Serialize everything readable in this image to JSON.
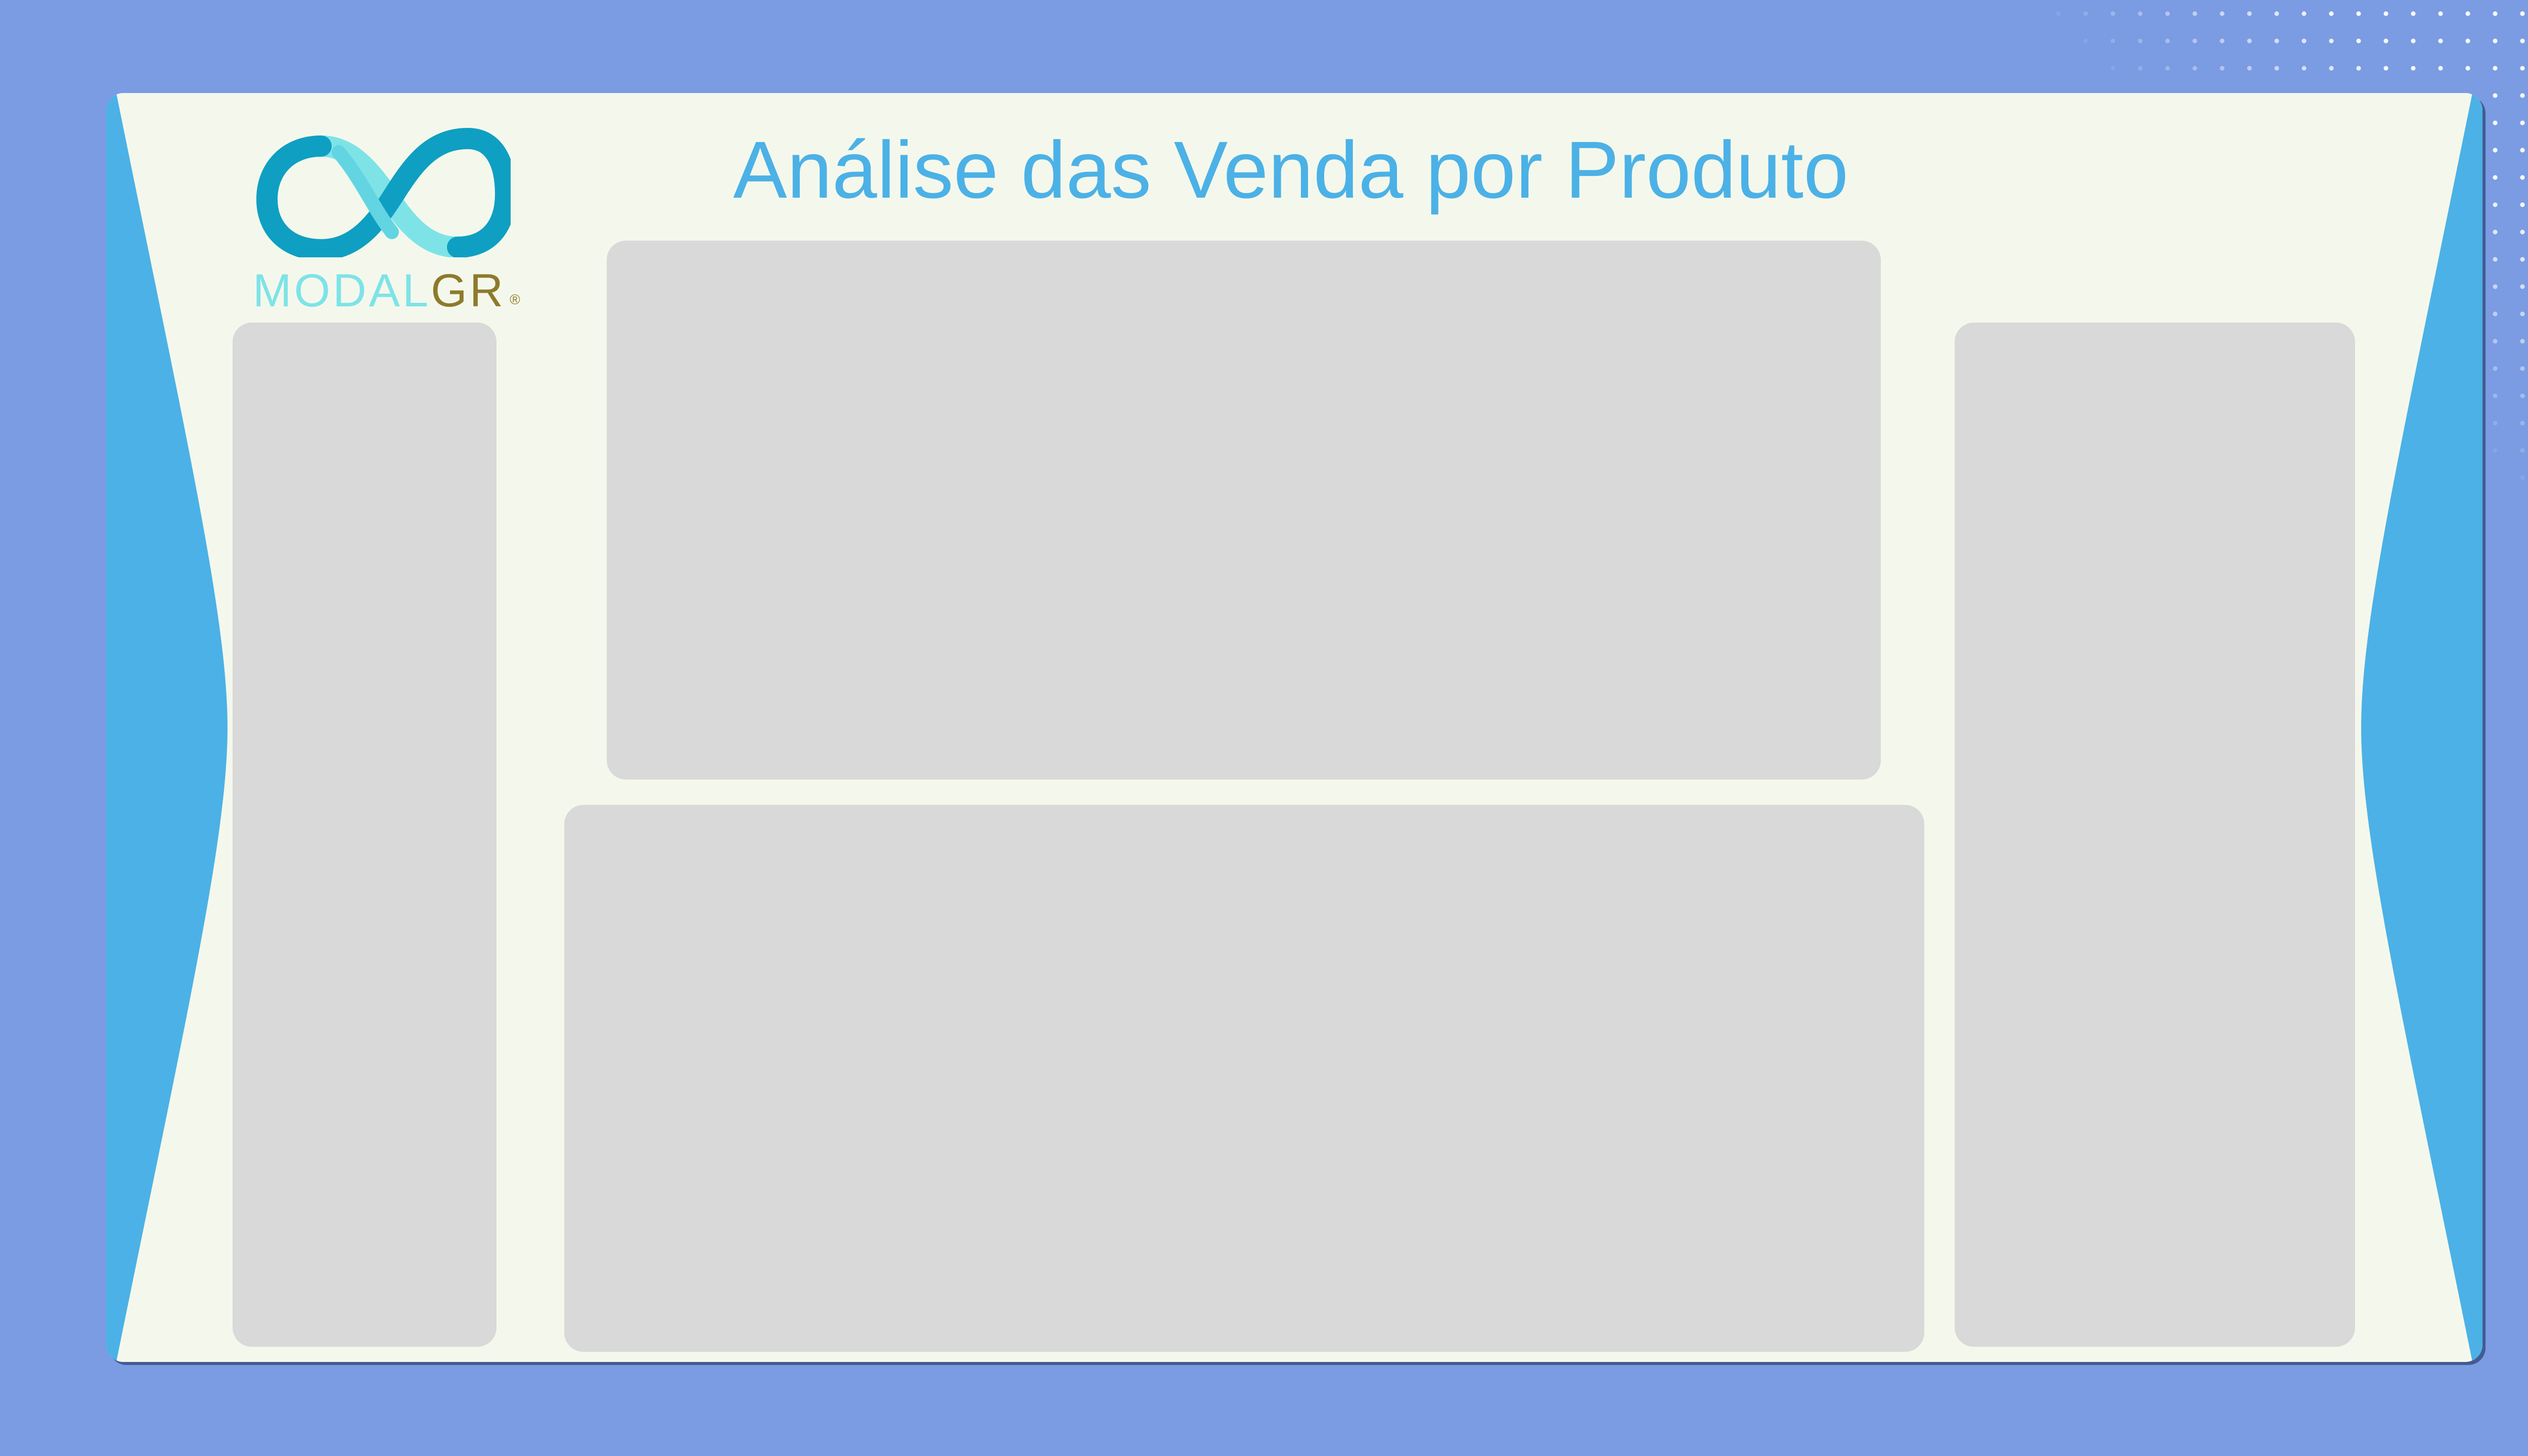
{
  "brand": {
    "logo_name": "MODAL",
    "logo_suffix": "GR",
    "registered_mark": "®",
    "colors": {
      "teal_light": "#7ee3e7",
      "teal_dark": "#0f9fc2",
      "gold": "#8f7a2b"
    }
  },
  "header": {
    "title": "Análise das Venda por Produto"
  },
  "theme": {
    "background": "#7b9be3",
    "card": "#f4f8ec",
    "accent_blue": "#4cb1e6",
    "placeholder_gray": "#d9d9d9"
  }
}
